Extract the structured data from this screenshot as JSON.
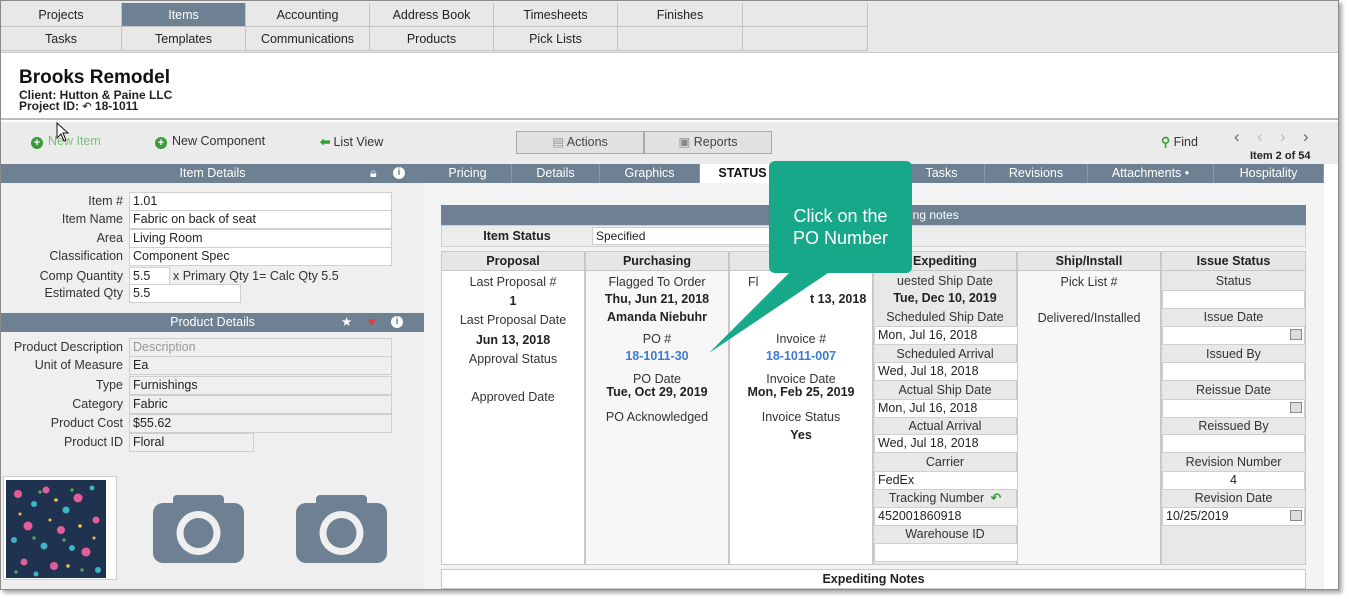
{
  "nav": {
    "row1": [
      "Projects",
      "Items",
      "Accounting",
      "Address Book",
      "Timesheets",
      "Finishes"
    ],
    "row2": [
      "Tasks",
      "Templates",
      "Communications",
      "Products",
      "Pick Lists"
    ]
  },
  "header": {
    "title": "Brooks Remodel",
    "client": "Client: Hutton & Paine LLC",
    "project_id_label": "Project ID:",
    "project_id": "18-1011"
  },
  "toolbar": {
    "new_item": "New Item",
    "new_component": "New Component",
    "list_view": "List View",
    "actions": "Actions",
    "reports": "Reports",
    "find": "Find",
    "item_count": "Item 2 of 54"
  },
  "tabs": [
    "Pricing",
    "Details",
    "Graphics",
    "STATUS",
    "Tasks",
    "Revisions",
    "Attachments •",
    "Hospitality"
  ],
  "item_details": {
    "title": "Item Details",
    "fields": [
      {
        "label": "Item #",
        "value": "1.01"
      },
      {
        "label": "Item Name",
        "value": "Fabric on back of seat"
      },
      {
        "label": "Area",
        "value": "Living Room"
      },
      {
        "label": "Classification",
        "value": "Component Spec"
      }
    ],
    "comp_qty_label": "Comp Quantity",
    "comp_qty_value": "5.5",
    "comp_qty_note": "x Primary Qty 1= Calc Qty 5.5",
    "est_qty_label": "Estimated Qty",
    "est_qty_value": "5.5"
  },
  "product_details": {
    "title": "Product Details",
    "fields": [
      {
        "label": "Product Description",
        "value": "Description"
      },
      {
        "label": "Unit of Measure",
        "value": "Ea"
      },
      {
        "label": "Type",
        "value": "Furnishings"
      },
      {
        "label": "Category",
        "value": "Fabric"
      },
      {
        "label": "Product Cost",
        "value": "$55.62"
      },
      {
        "label": "Product ID",
        "value": "Floral"
      }
    ]
  },
  "status": {
    "editing_notes": "iting notes",
    "item_status_label": "Item Status",
    "item_status_value": "Specified",
    "proposal": {
      "head": "Proposal",
      "last_proposal_label": "Last Proposal #",
      "last_proposal_value": "1",
      "last_proposal_date_label": "Last Proposal Date",
      "last_proposal_date_value": "Jun 13, 2018",
      "approval_status_label": "Approval Status",
      "approved_date_label": "Approved Date"
    },
    "purchasing": {
      "head": "Purchasing",
      "flagged_label": "Flagged To Order",
      "flagged_date": "Thu, Jun 21, 2018",
      "flagged_by": "Amanda Niebuhr",
      "po_label": "PO #",
      "po_value": "18-1011-30",
      "po_date_label": "PO Date",
      "po_date_value": "Tue, Oct 29, 2019",
      "po_ack_label": "PO Acknowledged"
    },
    "invoice": {
      "partial_label": "Fl",
      "partial_date": "t 13, 2018",
      "invoice_label": "Invoice #",
      "invoice_value": "18-1011-007",
      "invoice_date_label": "Invoice Date",
      "invoice_date_value": "Mon, Feb 25, 2019",
      "invoice_status_label": "Invoice Status",
      "invoice_status_value": "Yes"
    },
    "expediting": {
      "head": "Expediting",
      "requested_label": "uested Ship Date",
      "requested_value": "Tue, Dec 10, 2019",
      "sched_ship_label": "Scheduled Ship Date",
      "sched_ship_value": "Mon, Jul 16, 2018",
      "sched_arrival_label": "Scheduled Arrival",
      "sched_arrival_value": "Wed, Jul 18, 2018",
      "actual_ship_label": "Actual Ship Date",
      "actual_ship_value": "Mon, Jul 16, 2018",
      "actual_arrival_label": "Actual Arrival",
      "actual_arrival_value": "Wed, Jul 18, 2018",
      "carrier_label": "Carrier",
      "carrier_value": "FedEx",
      "tracking_label": "Tracking Number",
      "tracking_value": "452001860918",
      "warehouse_label": "Warehouse ID"
    },
    "ship_install": {
      "head": "Ship/Install",
      "pick_list_label": "Pick List #",
      "delivered_label": "Delivered/Installed"
    },
    "issue_status": {
      "head": "Issue Status",
      "status_label": "Status",
      "issue_date_label": "Issue Date",
      "issued_by_label": "Issued By",
      "reissue_date_label": "Reissue Date",
      "reissued_by_label": "Reissued By",
      "revision_number_label": "Revision Number",
      "revision_number_value": "4",
      "revision_date_label": "Revision Date",
      "revision_date_value": "10/25/2019"
    },
    "expediting_notes": "Expediting Notes"
  },
  "callout": {
    "line1": "Click on the",
    "line2": "PO Number",
    "color": "#17a88a"
  },
  "colors": {
    "accent": "#6d8193",
    "link": "#3a7bd5",
    "add_icon": "#3a9b3a"
  }
}
